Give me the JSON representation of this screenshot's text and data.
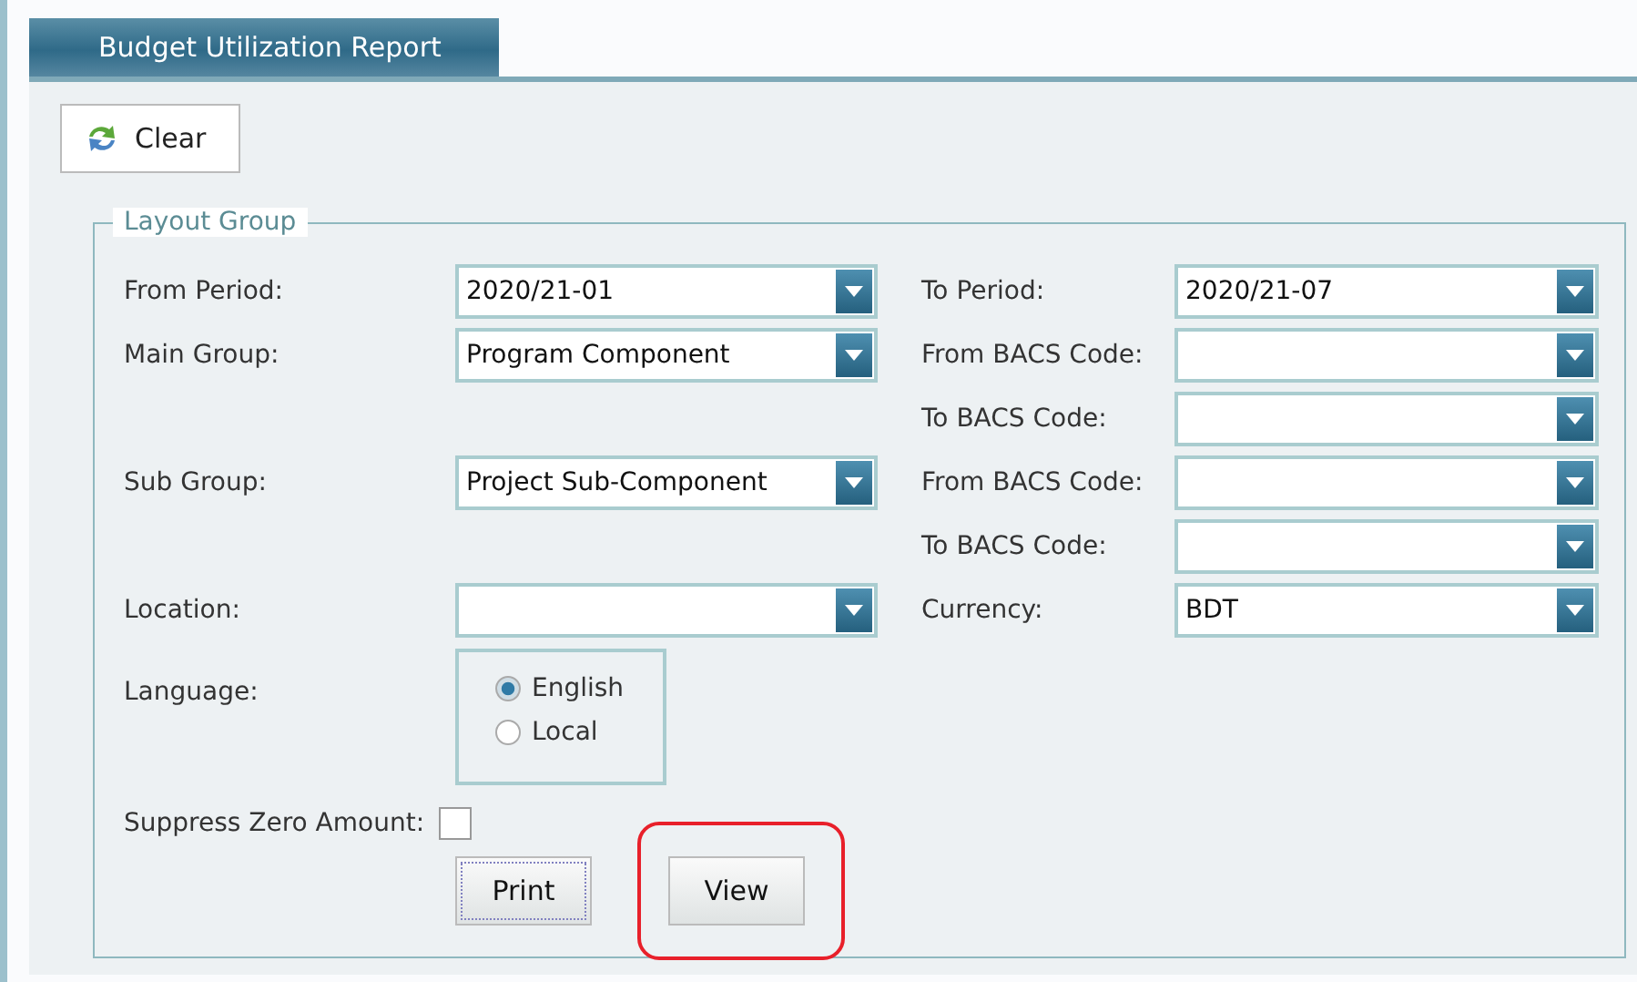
{
  "tab": {
    "label": "Budget Utilization Report",
    "selected": true
  },
  "toolbar": {
    "clear_button": "Clear"
  },
  "layout_group": {
    "title": "Layout Group",
    "rows": [
      {
        "left": {
          "label": "From Period:",
          "value": "2020/21-01"
        },
        "right": {
          "label": "To Period:",
          "value": "2020/21-07"
        }
      },
      {
        "left": {
          "label": "Main Group:",
          "value": "Program Component"
        },
        "right": {
          "label": "From BACS Code:"
        }
      },
      {
        "left": null,
        "right": {
          "label": "To BACS Code:"
        }
      },
      {
        "left": {
          "label": "Sub Group:",
          "value": "Project Sub-Component"
        },
        "right": {
          "label": "From BACS Code:"
        }
      },
      {
        "left": null,
        "right": {
          "label": "To BACS Code:"
        }
      },
      {
        "left": {
          "label": "Location:"
        },
        "right": {
          "label": "Currency:",
          "value": "BDT"
        }
      }
    ],
    "language": {
      "label": "Language:",
      "options": [
        {
          "label": "English",
          "selected": true
        },
        {
          "label": "Local",
          "selected": false
        }
      ]
    },
    "suppress_zero": {
      "label": "Suppress Zero Amount:",
      "checked": false
    },
    "buttons": [
      {
        "label": "Print",
        "focused": true,
        "highlighted": false
      },
      {
        "label": "View",
        "focused": false,
        "highlighted": true
      }
    ]
  }
}
